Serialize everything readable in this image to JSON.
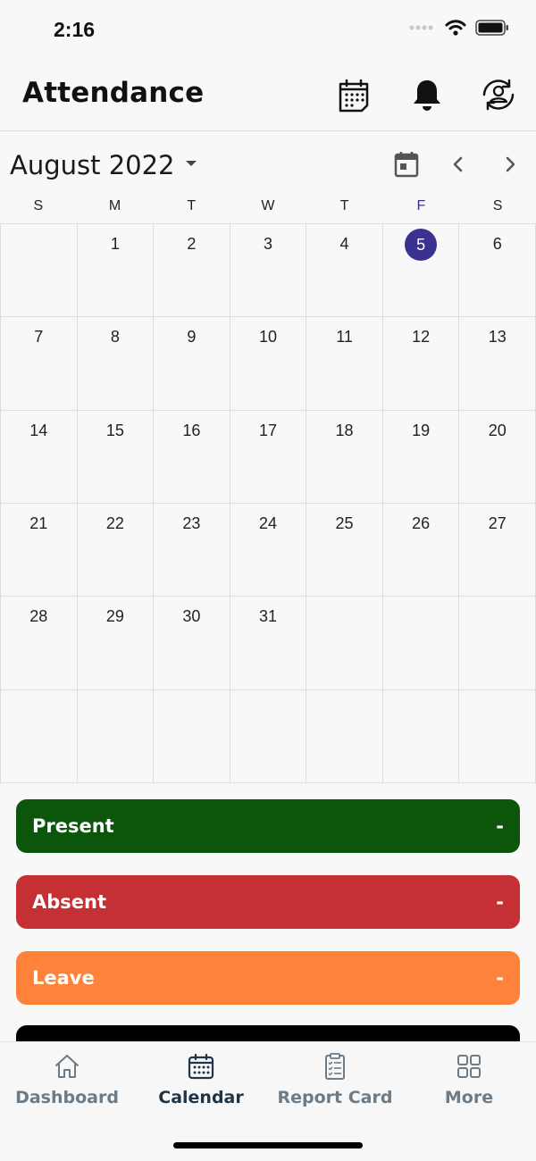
{
  "status_bar": {
    "time": "2:16"
  },
  "header": {
    "title": "Attendance"
  },
  "calendar": {
    "month_label": "August 2022",
    "weekdays": [
      "S",
      "M",
      "T",
      "W",
      "T",
      "F",
      "S"
    ],
    "selected_day": "5",
    "weeks": [
      [
        "",
        "1",
        "2",
        "3",
        "4",
        "5",
        "6"
      ],
      [
        "7",
        "8",
        "9",
        "10",
        "11",
        "12",
        "13"
      ],
      [
        "14",
        "15",
        "16",
        "17",
        "18",
        "19",
        "20"
      ],
      [
        "21",
        "22",
        "23",
        "24",
        "25",
        "26",
        "27"
      ],
      [
        "28",
        "29",
        "30",
        "31",
        "",
        "",
        ""
      ],
      [
        "",
        "",
        "",
        "",
        "",
        "",
        ""
      ]
    ]
  },
  "summary": [
    {
      "label": "Present",
      "value": "-",
      "color": "#0b560b"
    },
    {
      "label": "Absent",
      "value": "-",
      "color": "#c43034"
    },
    {
      "label": "Leave",
      "value": "-",
      "color": "#ff823b"
    }
  ],
  "tabs": [
    {
      "label": "Dashboard",
      "icon": "home-icon",
      "active": false
    },
    {
      "label": "Calendar",
      "icon": "calendar-icon",
      "active": true
    },
    {
      "label": "Report Card",
      "icon": "clipboard-icon",
      "active": false
    },
    {
      "label": "More",
      "icon": "grid-icon",
      "active": false
    }
  ],
  "colors": {
    "accent": "#3b3290",
    "tab_active": "#1f3547",
    "tab_inactive": "#6c7b86"
  }
}
